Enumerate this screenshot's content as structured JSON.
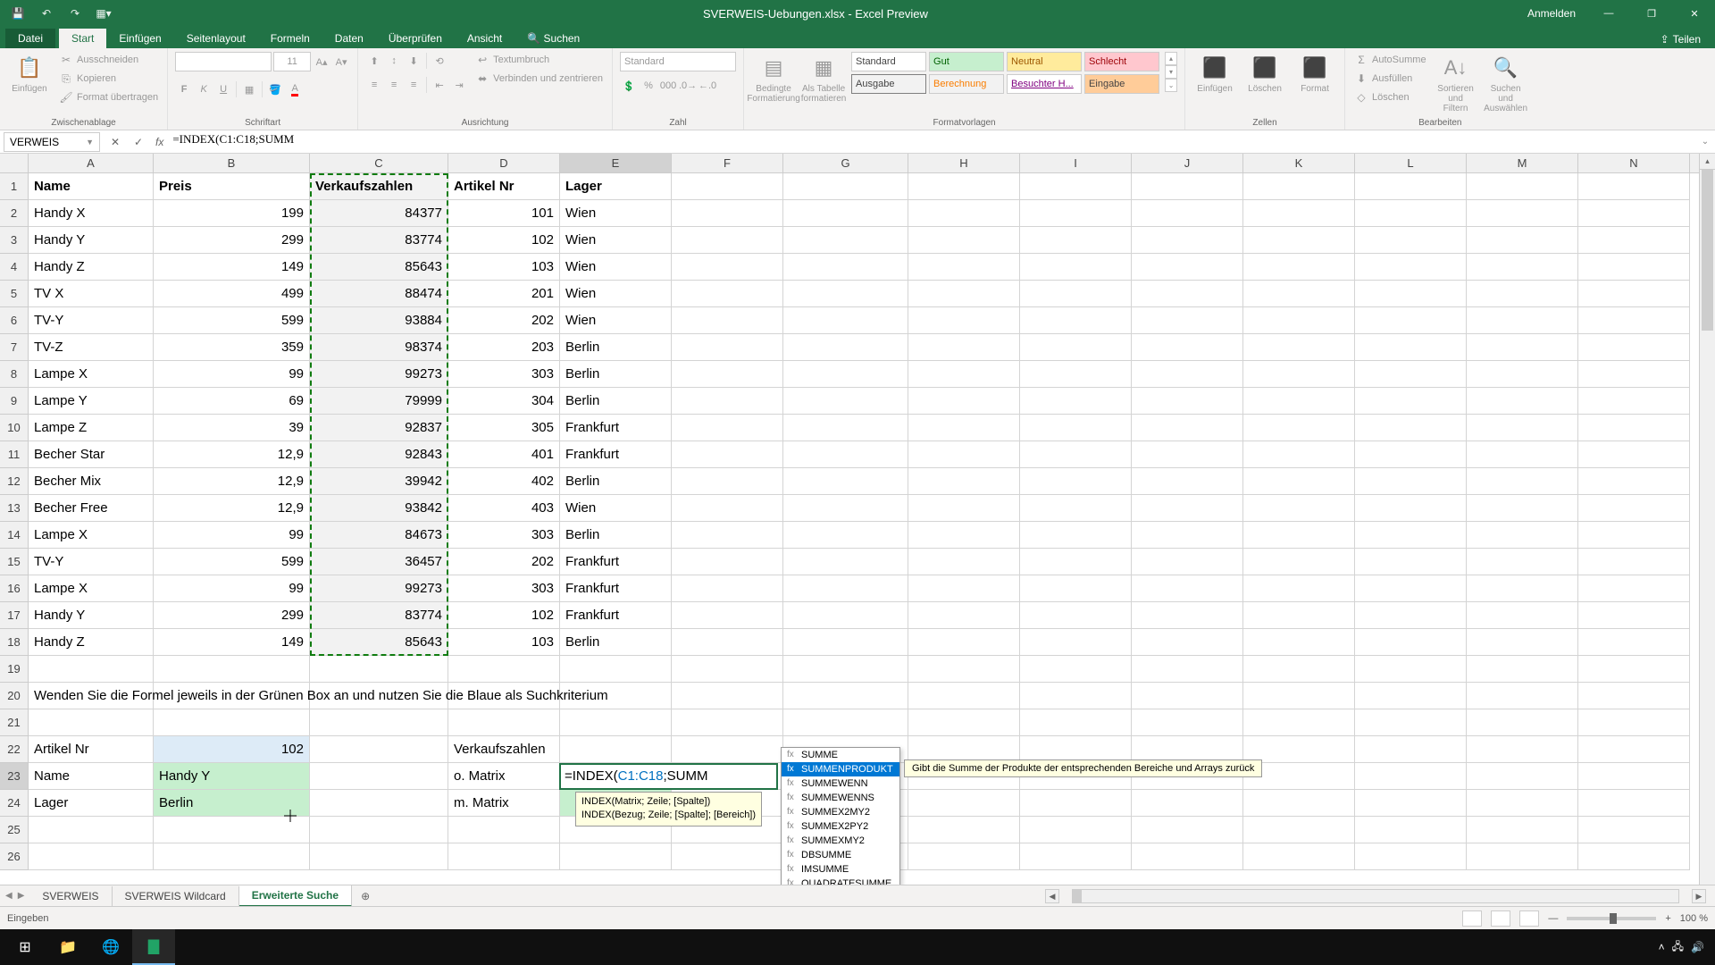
{
  "title": "SVERWEIS-Uebungen.xlsx - Excel Preview",
  "user_action": "Anmelden",
  "share_label": "Teilen",
  "tabs": {
    "file": "Datei",
    "home": "Start",
    "insert": "Einfügen",
    "layout": "Seitenlayout",
    "formulas": "Formeln",
    "data": "Daten",
    "review": "Überprüfen",
    "view": "Ansicht",
    "search": "Suchen"
  },
  "ribbon": {
    "clipboard": {
      "paste": "Einfügen",
      "cut": "Ausschneiden",
      "copy": "Kopieren",
      "format_painter": "Format übertragen",
      "label": "Zwischenablage"
    },
    "font": {
      "size": "11",
      "label": "Schriftart"
    },
    "alignment": {
      "wrap": "Textumbruch",
      "merge": "Verbinden und zentrieren",
      "label": "Ausrichtung"
    },
    "number": {
      "format": "Standard",
      "label": "Zahl"
    },
    "styles": {
      "conditional": "Bedingte Formatierung",
      "as_table": "Als Tabelle formatieren",
      "label": "Formatvorlagen",
      "items": [
        "Standard",
        "Gut",
        "Neutral",
        "Schlecht",
        "Ausgabe",
        "Berechnung",
        "Besuchter H...",
        "Eingabe"
      ]
    },
    "cells": {
      "insert": "Einfügen",
      "delete": "Löschen",
      "format": "Format",
      "label": "Zellen"
    },
    "editing": {
      "autosum": "AutoSumme",
      "fill": "Ausfüllen",
      "clear": "Löschen",
      "sort": "Sortieren und Filtern",
      "find": "Suchen und Auswählen",
      "label": "Bearbeiten"
    }
  },
  "name_box": "VERWEIS",
  "formula_bar": "=INDEX(C1:C18;SUMM",
  "columns": [
    "A",
    "B",
    "C",
    "D",
    "E",
    "F",
    "G",
    "H",
    "I",
    "J",
    "K",
    "L",
    "M",
    "N"
  ],
  "grid": {
    "headers": {
      "A": "Name",
      "B": "Preis",
      "C": "Verkaufszahlen",
      "D": "Artikel Nr",
      "E": "Lager"
    },
    "rows": [
      {
        "A": "Handy X",
        "B": "199",
        "C": "84377",
        "D": "101",
        "E": "Wien"
      },
      {
        "A": "Handy Y",
        "B": "299",
        "C": "83774",
        "D": "102",
        "E": "Wien"
      },
      {
        "A": "Handy Z",
        "B": "149",
        "C": "85643",
        "D": "103",
        "E": "Wien"
      },
      {
        "A": "TV X",
        "B": "499",
        "C": "88474",
        "D": "201",
        "E": "Wien"
      },
      {
        "A": "TV-Y",
        "B": "599",
        "C": "93884",
        "D": "202",
        "E": "Wien"
      },
      {
        "A": "TV-Z",
        "B": "359",
        "C": "98374",
        "D": "203",
        "E": "Berlin"
      },
      {
        "A": "Lampe X",
        "B": "99",
        "C": "99273",
        "D": "303",
        "E": "Berlin"
      },
      {
        "A": "Lampe Y",
        "B": "69",
        "C": "79999",
        "D": "304",
        "E": "Berlin"
      },
      {
        "A": "Lampe Z",
        "B": "39",
        "C": "92837",
        "D": "305",
        "E": "Frankfurt"
      },
      {
        "A": "Becher Star",
        "B": "12,9",
        "C": "92843",
        "D": "401",
        "E": "Frankfurt"
      },
      {
        "A": "Becher Mix",
        "B": "12,9",
        "C": "39942",
        "D": "402",
        "E": "Berlin"
      },
      {
        "A": "Becher Free",
        "B": "12,9",
        "C": "93842",
        "D": "403",
        "E": "Wien"
      },
      {
        "A": "Lampe X",
        "B": "99",
        "C": "84673",
        "D": "303",
        "E": "Berlin"
      },
      {
        "A": "TV-Y",
        "B": "599",
        "C": "36457",
        "D": "202",
        "E": "Frankfurt"
      },
      {
        "A": "Lampe X",
        "B": "99",
        "C": "99273",
        "D": "303",
        "E": "Frankfurt"
      },
      {
        "A": "Handy Y",
        "B": "299",
        "C": "83774",
        "D": "102",
        "E": "Frankfurt"
      },
      {
        "A": "Handy Z",
        "B": "149",
        "C": "85643",
        "D": "103",
        "E": "Berlin"
      }
    ],
    "instruction": "Wenden Sie die Formel jeweils in der Grünen Box an und nutzen Sie die Blaue als Suchkriterium",
    "lookup": {
      "r22": {
        "A": "Artikel Nr",
        "B": "102",
        "D": "Verkaufszahlen"
      },
      "r23": {
        "A": "Name",
        "B": "Handy Y",
        "D": "o. Matrix"
      },
      "r24": {
        "A": "Lager",
        "B": "Berlin",
        "D": "m. Matrix"
      }
    }
  },
  "editing_cell": {
    "prefix": "=INDEX(",
    "ref": "C1:C18",
    "suffix": ";SUMM"
  },
  "syntax_tip": {
    "line1": "INDEX(Matrix; Zeile; [Spalte])",
    "line2": "INDEX(Bezug; Zeile; [Spalte]; [Bereich])"
  },
  "func_list": [
    "SUMME",
    "SUMMENPRODUKT",
    "SUMMEWENN",
    "SUMMEWENNS",
    "SUMMEX2MY2",
    "SUMMEX2PY2",
    "SUMMEXMY2",
    "DBSUMME",
    "IMSUMME",
    "QUADRATESUMME"
  ],
  "func_tip": "Gibt die Summe der Produkte der entsprechenden Bereiche und Arrays zurück",
  "sheets": [
    "SVERWEIS",
    "SVERWEIS Wildcard",
    "Erweiterte Suche"
  ],
  "status": "Eingeben",
  "zoom": "100 %"
}
